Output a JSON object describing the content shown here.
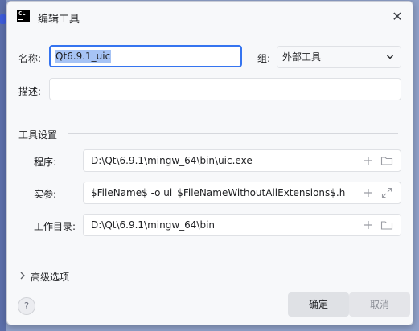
{
  "window": {
    "title": "编辑工具",
    "app_icon_text": "CL",
    "close_glyph": "✕"
  },
  "form": {
    "name_label": "名称:",
    "name_value": "Qt6.9.1_uic",
    "group_label": "组:",
    "group_value": "外部工具",
    "description_label": "描述:",
    "description_value": ""
  },
  "tool_settings": {
    "section_title": "工具设置",
    "program_label": "程序:",
    "program_value": "D:\\Qt\\6.9.1\\mingw_64\\bin\\uic.exe",
    "args_label": "实参:",
    "args_value": "$FileName$ -o ui_$FileNameWithoutAllExtensions$.h",
    "workdir_label": "工作目录:",
    "workdir_value": "D:\\Qt\\6.9.1\\mingw_64\\bin"
  },
  "advanced": {
    "label": "高级选项"
  },
  "buttons": {
    "help": "?",
    "ok": "确定",
    "cancel": "取消"
  },
  "icons": {
    "add": "plus-icon",
    "folder": "folder-icon",
    "expand": "expand-icon",
    "chevron": "chevron-down-icon"
  },
  "colors": {
    "focus_border": "#3574f0",
    "selection": "#a6c3f5"
  }
}
